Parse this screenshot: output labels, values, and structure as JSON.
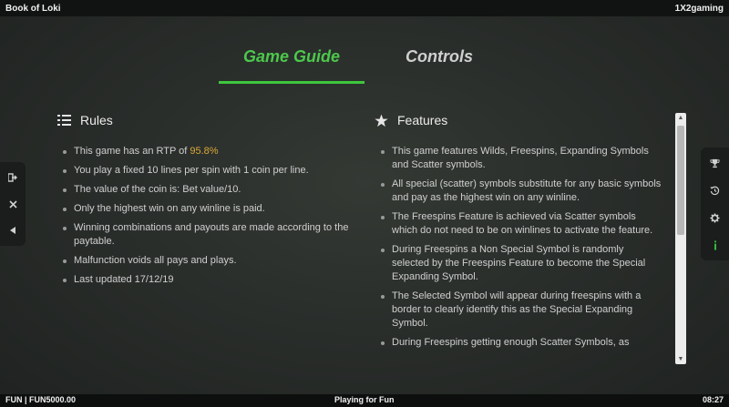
{
  "header": {
    "title": "Book of Loki",
    "brand": "1X2gaming"
  },
  "tabs": [
    {
      "label": "Game Guide",
      "active": true
    },
    {
      "label": "Controls",
      "active": false
    }
  ],
  "rules": {
    "title": "Rules",
    "items": [
      {
        "text": "This game has an RTP of ",
        "highlight": "95.8%"
      },
      {
        "text": "You play a fixed 10 lines per spin with 1 coin per line."
      },
      {
        "text": "The value of the coin is: Bet value/10."
      },
      {
        "text": "Only the highest win on any winline is paid."
      },
      {
        "text": "Winning combinations and payouts are made according to the paytable."
      },
      {
        "text": "Malfunction voids all pays and plays."
      },
      {
        "text": "Last updated 17/12/19"
      }
    ]
  },
  "features": {
    "title": "Features",
    "items": [
      "This game features Wilds, Freespins, Expanding Symbols and Scatter symbols.",
      "All special (scatter) symbols substitute for any basic symbols and pay as the highest win on any winline.",
      "The Freespins Feature is achieved via Scatter symbols which do not need to be on winlines to activate the feature.",
      "During Freespins a Non Special Symbol is randomly selected by the Freespins Feature to become the Special Expanding Symbol.",
      "The Selected Symbol will appear during freespins with a border to clearly identify this as the Special Expanding Symbol.",
      "During Freespins getting enough Scatter Symbols, as"
    ]
  },
  "footer": {
    "balance": "FUN | FUN5000.00",
    "mode": "Playing for Fun",
    "time": "08:27"
  },
  "icons": {
    "left": [
      "exit-icon",
      "close-icon",
      "back-icon"
    ],
    "right": [
      "trophy-icon",
      "history-icon",
      "settings-icon",
      "info-icon"
    ]
  },
  "colors": {
    "accent": "#3ec73e",
    "highlight": "#d9a838",
    "background": "#2a2e2b"
  }
}
